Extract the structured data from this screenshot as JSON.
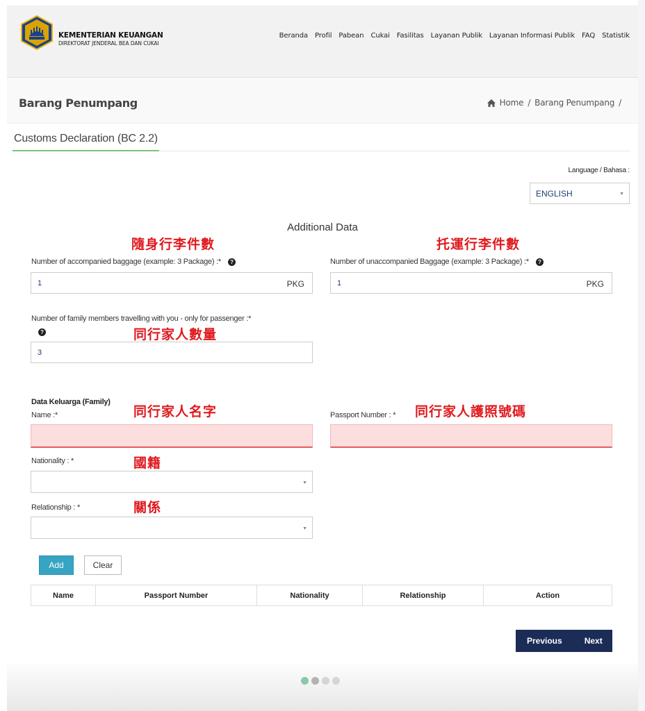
{
  "header": {
    "org_name": "KEMENTERIAN KEUANGAN",
    "org_sub": "DIREKTORAT JENDERAL BEA DAN CUKAI",
    "nav": [
      "Beranda",
      "Profil",
      "Pabean",
      "Cukai",
      "Fasilitas",
      "Layanan Publik",
      "Layanan Informasi Publik",
      "FAQ",
      "Statistik"
    ]
  },
  "page": {
    "title": "Barang Penumpang",
    "breadcrumb": {
      "home": "Home",
      "sep": "/",
      "current": "Barang Penumpang",
      "trailing": "/"
    },
    "tab": "Customs Declaration (BC 2.2)"
  },
  "language": {
    "label": "Language / Bahasa :",
    "value": "ENGLISH"
  },
  "form": {
    "section_title": "Additional Data",
    "accompanied": {
      "label": "Number of accompanied baggage (example: 3 Package) :*",
      "value": "1",
      "unit": "PKG"
    },
    "unaccompanied": {
      "label": "Number of unaccompanied Baggage (example: 3 Package) :*",
      "value": "1",
      "unit": "PKG"
    },
    "family_count": {
      "label": "Number of family members travelling with you - only for passenger :*",
      "value": "3"
    },
    "family_section": "Data Keluarga (Family)",
    "name_label": "Name :*",
    "passport_label": "Passport Number : *",
    "nationality_label": "Nationality : *",
    "relationship_label": "Relationship : *",
    "add": "Add",
    "clear": "Clear",
    "table_headers": [
      "Name",
      "Passport Number",
      "Nationality",
      "Relationship",
      "Action"
    ]
  },
  "annotations": {
    "accompanied": "隨身行李件數",
    "unaccompanied": "托運行李件數",
    "family_count": "同行家人數量",
    "family_name": "同行家人名字",
    "family_passport": "同行家人護照號碼",
    "nationality": "國籍",
    "relationship": "關係"
  },
  "pager": {
    "previous": "Previous",
    "next": "Next"
  },
  "colors": {
    "accent": "#37a4c1",
    "nav_button": "#1b2c56",
    "annotation": "#e0191e",
    "error_bg": "#fcdede"
  },
  "icons": {
    "logo": "garuda-emblem-icon",
    "home": "home-icon",
    "help": "question-circle-icon",
    "caret": "caret-down-icon"
  }
}
